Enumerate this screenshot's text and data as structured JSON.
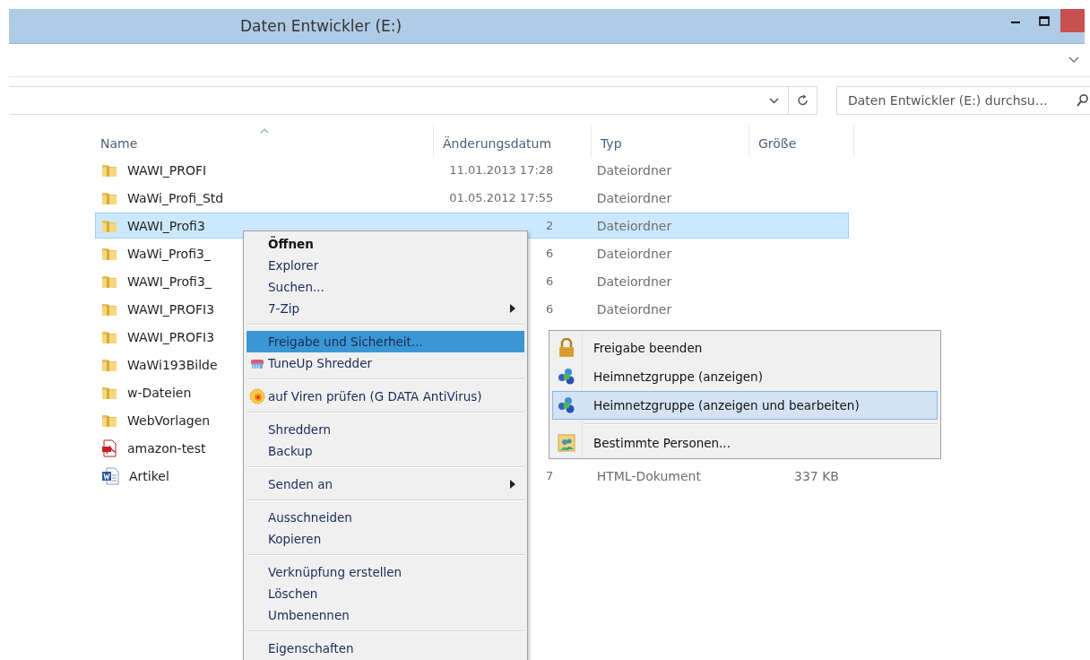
{
  "window": {
    "title": "Daten Entwickler (E:)"
  },
  "search": {
    "placeholder": "Daten Entwickler (E:) durchsu…"
  },
  "table": {
    "columns": [
      {
        "label": "Name",
        "sorted": true
      },
      {
        "label": "Änderungsdatum",
        "sorted": false
      },
      {
        "label": "Typ",
        "sorted": false
      },
      {
        "label": "Größe",
        "sorted": false
      }
    ],
    "rows": [
      {
        "kind": "folder",
        "name": "WAWI_PROFI",
        "date": "11.01.2013 17:28",
        "type": "Dateiordner",
        "selected": false
      },
      {
        "kind": "folder",
        "name": "WaWi_Profi_Std",
        "date": "01.05.2012 17:55",
        "type": "Dateiordner",
        "selected": false
      },
      {
        "kind": "folder",
        "name": "WAWI_Profi3",
        "date": "2",
        "type": "Dateiordner",
        "selected": true
      },
      {
        "kind": "folder",
        "name": "WaWi_Profi3_",
        "date": "6",
        "type": "Dateiordner",
        "selected": false
      },
      {
        "kind": "folder",
        "name": "WAWI_Profi3_",
        "date": "6",
        "type": "Dateiordner",
        "selected": false
      },
      {
        "kind": "folder",
        "name": "WAWI_PROFI3",
        "date": "6",
        "type": "Dateiordner",
        "selected": false
      },
      {
        "kind": "folder",
        "name": "WAWI_PROFI3",
        "selected": false
      },
      {
        "kind": "folder",
        "name": "WaWi193Bilde",
        "selected": false
      },
      {
        "kind": "folder",
        "name": "w-Dateien",
        "selected": false
      },
      {
        "kind": "folder",
        "name": "WebVorlagen",
        "selected": false
      },
      {
        "kind": "pdf",
        "name": "amazon-test",
        "selected": false
      },
      {
        "kind": "word",
        "name": "Artikel",
        "date": "7",
        "type": "HTML-Dokument",
        "size": "337 KB",
        "selected": false
      }
    ]
  },
  "context_menu": {
    "items": [
      {
        "kind": "plain",
        "label": "Öffnen",
        "default": true,
        "submenu": false,
        "selected": false
      },
      {
        "kind": "plain",
        "label": "Explorer",
        "default": false,
        "submenu": false,
        "selected": false
      },
      {
        "kind": "plain",
        "label": "Suchen...",
        "default": false,
        "submenu": false,
        "selected": false
      },
      {
        "kind": "plain",
        "label": "7-Zip",
        "default": false,
        "submenu": true,
        "selected": false
      },
      {
        "kind": "separator"
      },
      {
        "kind": "plain",
        "label": "Freigabe und Sicherheit...",
        "default": false,
        "submenu": false,
        "selected": true
      },
      {
        "kind": "shredder",
        "label": "TuneUp Shredder",
        "default": false,
        "submenu": false,
        "selected": false
      },
      {
        "kind": "separator"
      },
      {
        "kind": "antivirus",
        "label": "auf Viren prüfen (G DATA AntiVirus)",
        "default": false,
        "submenu": false,
        "selected": false
      },
      {
        "kind": "separator"
      },
      {
        "kind": "plain",
        "label": "Shreddern",
        "default": false,
        "submenu": false,
        "selected": false
      },
      {
        "kind": "plain",
        "label": "Backup",
        "default": false,
        "submenu": false,
        "selected": false
      },
      {
        "kind": "separator"
      },
      {
        "kind": "plain",
        "label": "Senden an",
        "default": false,
        "submenu": true,
        "selected": false
      },
      {
        "kind": "separator"
      },
      {
        "kind": "plain",
        "label": "Ausschneiden",
        "default": false,
        "submenu": false,
        "selected": false
      },
      {
        "kind": "plain",
        "label": "Kopieren",
        "default": false,
        "submenu": false,
        "selected": false
      },
      {
        "kind": "separator"
      },
      {
        "kind": "plain",
        "label": "Verknüpfung erstellen",
        "default": false,
        "submenu": false,
        "selected": false
      },
      {
        "kind": "plain",
        "label": "Löschen",
        "default": false,
        "submenu": false,
        "selected": false
      },
      {
        "kind": "plain",
        "label": "Umbenennen",
        "default": false,
        "submenu": false,
        "selected": false
      },
      {
        "kind": "separator"
      },
      {
        "kind": "plain",
        "label": "Eigenschaften",
        "default": false,
        "submenu": false,
        "selected": false
      }
    ]
  },
  "submenu": {
    "items": [
      {
        "kind": "lock",
        "label": "Freigabe beenden",
        "selected": false
      },
      {
        "kind": "homegroup",
        "label": "Heimnetzgruppe (anzeigen)",
        "selected": false
      },
      {
        "kind": "homegroup",
        "label": "Heimnetzgruppe (anzeigen und bearbeiten)",
        "selected": true
      },
      {
        "kind": "separator"
      },
      {
        "kind": "people",
        "label": "Bestimmte Personen...",
        "selected": false
      }
    ]
  }
}
